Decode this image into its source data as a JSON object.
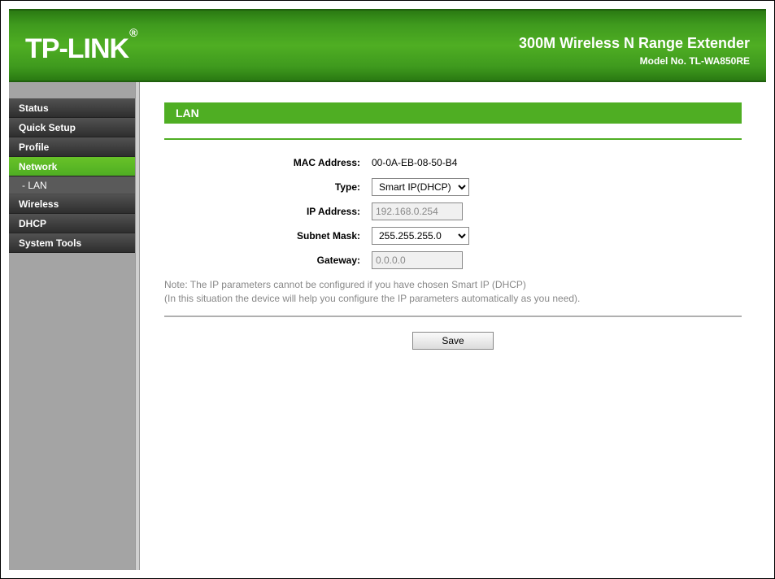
{
  "brand": "TP-LINK",
  "header": {
    "title": "300M Wireless N Range Extender",
    "model": "Model No. TL-WA850RE"
  },
  "sidebar": {
    "items": {
      "status": "Status",
      "quick_setup": "Quick Setup",
      "profile": "Profile",
      "network": "Network",
      "lan": "- LAN",
      "wireless": "Wireless",
      "dhcp": "DHCP",
      "system_tools": "System Tools"
    }
  },
  "page": {
    "title": "LAN",
    "labels": {
      "mac": "MAC Address:",
      "type": "Type:",
      "ip": "IP Address:",
      "mask": "Subnet Mask:",
      "gateway": "Gateway:"
    },
    "values": {
      "mac": "00-0A-EB-08-50-B4",
      "type": "Smart IP(DHCP)",
      "ip": "192.168.0.254",
      "mask": "255.255.255.0",
      "gateway": "0.0.0.0"
    },
    "note_line1": "Note: The IP parameters cannot be configured if you have chosen Smart IP (DHCP)",
    "note_line2": "(In this situation the device will help you configure the IP parameters automatically as you need).",
    "save": "Save"
  }
}
